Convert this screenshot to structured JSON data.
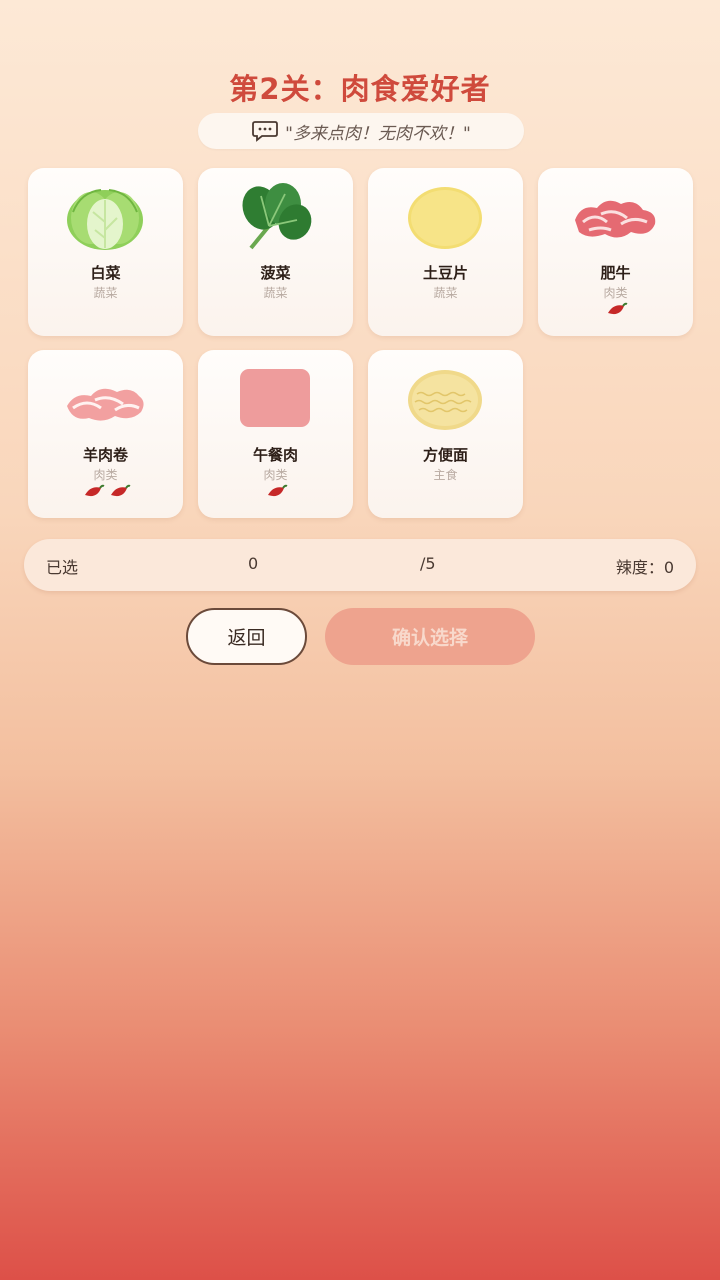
{
  "level": {
    "title": "第2关：肉食爱好者",
    "quote": "\"多来点肉！无肉不欢！\""
  },
  "ingredients": [
    {
      "name": "白菜",
      "category": "蔬菜",
      "spice": 0,
      "icon": "cabbage-icon"
    },
    {
      "name": "菠菜",
      "category": "蔬菜",
      "spice": 0,
      "icon": "spinach-icon"
    },
    {
      "name": "土豆片",
      "category": "蔬菜",
      "spice": 0,
      "icon": "potato-slice-icon"
    },
    {
      "name": "肥牛",
      "category": "肉类",
      "spice": 1,
      "icon": "beef-slices-icon"
    },
    {
      "name": "羊肉卷",
      "category": "肉类",
      "spice": 2,
      "icon": "lamb-roll-icon"
    },
    {
      "name": "午餐肉",
      "category": "肉类",
      "spice": 1,
      "icon": "luncheon-meat-icon"
    },
    {
      "name": "方便面",
      "category": "主食",
      "spice": 0,
      "icon": "instant-noodles-icon"
    }
  ],
  "status": {
    "selected_label": "已选",
    "selected_count": "0",
    "selected_max": "/5",
    "spice_text": "辣度：0"
  },
  "buttons": {
    "back": "返回",
    "confirm": "确认选择"
  },
  "colors": {
    "title": "#cf4a3c",
    "confirm_disabled": "#eea38e"
  }
}
